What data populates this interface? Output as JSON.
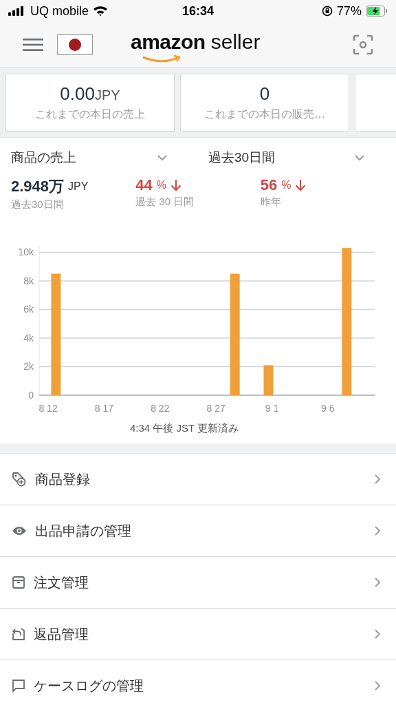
{
  "status_bar": {
    "carrier": "UQ mobile",
    "time": "16:34",
    "battery": "77%"
  },
  "header": {
    "logo_word": "amazon",
    "logo_suffix": "seller"
  },
  "cards": [
    {
      "value": "0.00",
      "unit": "JPY",
      "label": "これまでの本日の売上"
    },
    {
      "value": "0",
      "label": "これまでの本日の販売…"
    }
  ],
  "filters": [
    {
      "label": "商品の売上"
    },
    {
      "label": "過去30日間"
    }
  ],
  "metrics": [
    {
      "kind": "total",
      "value": "2.948万",
      "unit": "JPY",
      "label": "過去30日間"
    },
    {
      "kind": "change",
      "value": "44",
      "unit": "%",
      "label": "過去 30 日間"
    },
    {
      "kind": "change",
      "value": "56",
      "unit": "%",
      "label": "昨年"
    }
  ],
  "chart_data": {
    "type": "bar",
    "grid": true,
    "categories": [
      "8 12",
      null,
      null,
      null,
      null,
      "8 17",
      null,
      null,
      null,
      null,
      "8 22",
      null,
      null,
      null,
      null,
      "8 27",
      null,
      null,
      null,
      null,
      "9 1",
      null,
      null,
      null,
      null,
      "9 6",
      null,
      null,
      null,
      null
    ],
    "ylim": [
      0,
      10500
    ],
    "values": [
      null,
      8500,
      null,
      null,
      null,
      null,
      null,
      null,
      null,
      null,
      null,
      null,
      null,
      null,
      null,
      null,
      null,
      8500,
      null,
      null,
      2100,
      null,
      null,
      null,
      null,
      null,
      null,
      10300,
      null,
      null
    ],
    "yticks": [
      {
        "value": 0,
        "label": "0"
      },
      {
        "value": 2000,
        "label": "2k"
      },
      {
        "value": 4000,
        "label": "4k"
      },
      {
        "value": 6000,
        "label": "6k"
      },
      {
        "value": 8000,
        "label": "8k"
      },
      {
        "value": 10000,
        "label": "10k"
      }
    ]
  },
  "updated": "4:34 午後 JST 更新済み",
  "menu": [
    {
      "kind": "tag",
      "label": "商品登録"
    },
    {
      "kind": "eye",
      "label": "出品申請の管理"
    },
    {
      "kind": "box",
      "label": "注文管理"
    },
    {
      "kind": "return",
      "label": "返品管理"
    },
    {
      "kind": "chat",
      "label": "ケースログの管理"
    }
  ]
}
